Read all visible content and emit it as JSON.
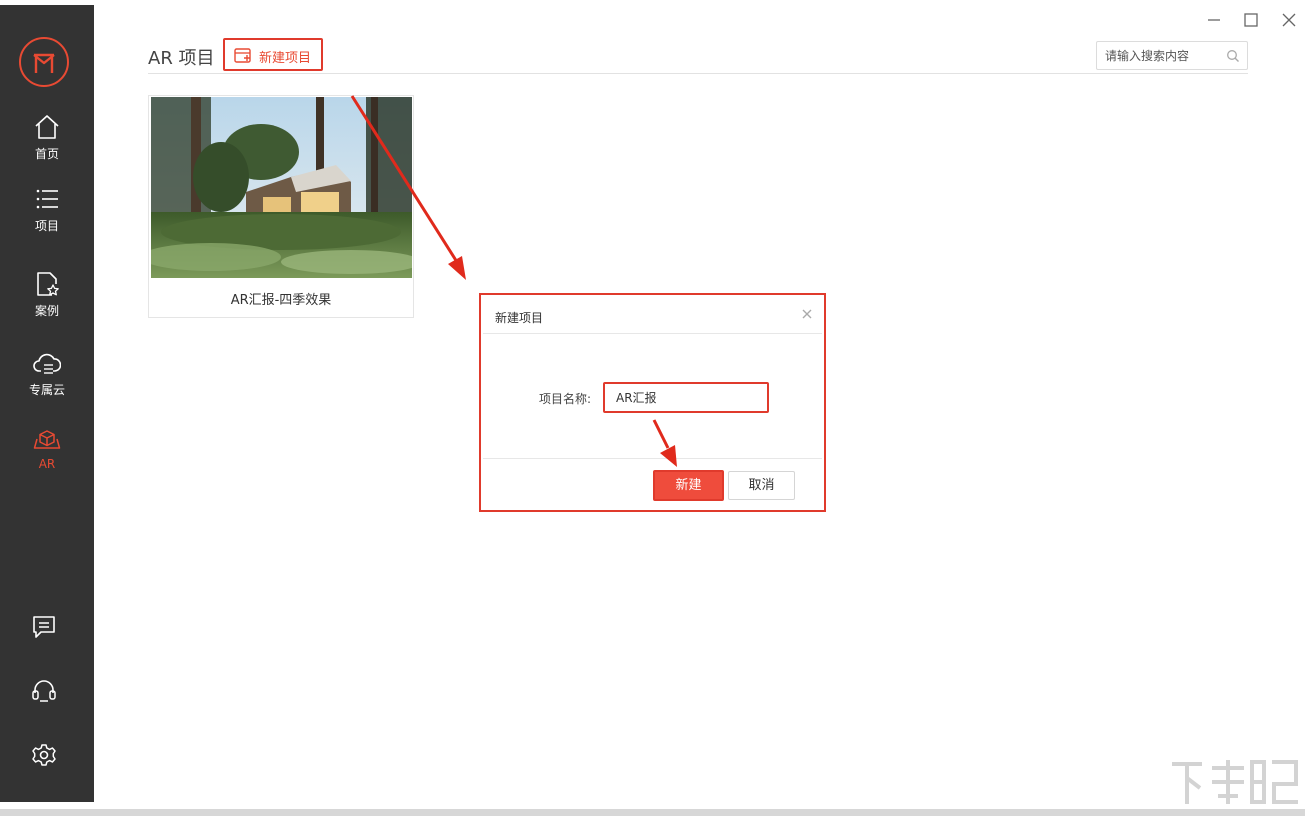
{
  "sidebar": {
    "logo_icon": "m-logo-icon",
    "items": [
      {
        "label": "首页",
        "icon": "home-icon"
      },
      {
        "label": "项目",
        "icon": "list-icon"
      },
      {
        "label": "案例",
        "icon": "case-star-icon"
      },
      {
        "label": "专属云",
        "icon": "cloud-icon"
      },
      {
        "label": "AR",
        "icon": "ar-cube-icon",
        "active": true
      }
    ],
    "bottom_icons": [
      "message-icon",
      "headset-icon",
      "gear-icon"
    ]
  },
  "window_controls": [
    "minimize-icon",
    "maximize-icon",
    "close-icon"
  ],
  "header": {
    "title": "AR 项目",
    "new_button_label": "新建项目",
    "search_placeholder": "请输入搜索内容"
  },
  "projects": [
    {
      "title": "AR汇报-四季效果"
    }
  ],
  "dialog": {
    "title": "新建项目",
    "field_label": "项目名称:",
    "field_value": "AR汇报",
    "create_label": "新建",
    "cancel_label": "取消"
  },
  "colors": {
    "sidebar_bg": "#333333",
    "accent": "#e84a33",
    "highlight_border": "#e03a2c"
  }
}
